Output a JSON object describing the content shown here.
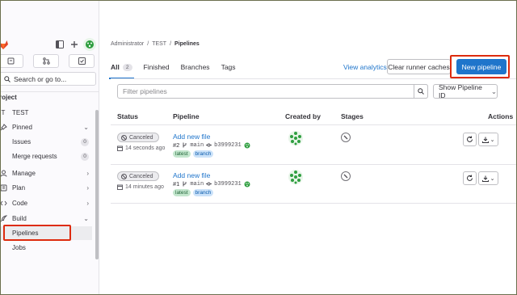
{
  "sidebar": {
    "search_label": "Search or go to...",
    "section_label": "roject",
    "project_initial": "T",
    "project_name": "TEST",
    "items": [
      {
        "label": "Pinned"
      },
      {
        "label": "Issues",
        "count": "0"
      },
      {
        "label": "Merge requests",
        "count": "0"
      },
      {
        "label": "Manage"
      },
      {
        "label": "Plan"
      },
      {
        "label": "Code"
      },
      {
        "label": "Build"
      },
      {
        "label": "Pipelines"
      },
      {
        "label": "Jobs"
      }
    ]
  },
  "breadcrumb": {
    "items": [
      "Administrator",
      "TEST",
      "Pipelines"
    ],
    "separator": "/"
  },
  "tabs": {
    "all_label": "All",
    "all_count": "2",
    "finished": "Finished",
    "branches": "Branches",
    "tags": "Tags"
  },
  "header": {
    "analytics": "View analytics",
    "clear_caches": "Clear runner caches",
    "new_pipeline": "New pipeline"
  },
  "filter": {
    "placeholder": "Filter pipelines",
    "sort_label": "Show Pipeline ID"
  },
  "table": {
    "headers": [
      "Status",
      "Pipeline",
      "Created by",
      "Stages",
      "Actions"
    ],
    "rows": [
      {
        "status": "Canceled",
        "time": "14 seconds ago",
        "title": "Add new file",
        "id": "#2",
        "branch": "main",
        "commit": "b3999231",
        "tags": [
          "latest",
          "branch"
        ]
      },
      {
        "status": "Canceled",
        "time": "14 minutes ago",
        "title": "Add new file",
        "id": "#1",
        "branch": "main",
        "commit": "b3999231",
        "tags": [
          "latest",
          "branch"
        ]
      }
    ]
  },
  "colors": {
    "accent": "#1f75cb",
    "highlight": "#dd2b0e",
    "avatar": "#2e9e3f"
  }
}
